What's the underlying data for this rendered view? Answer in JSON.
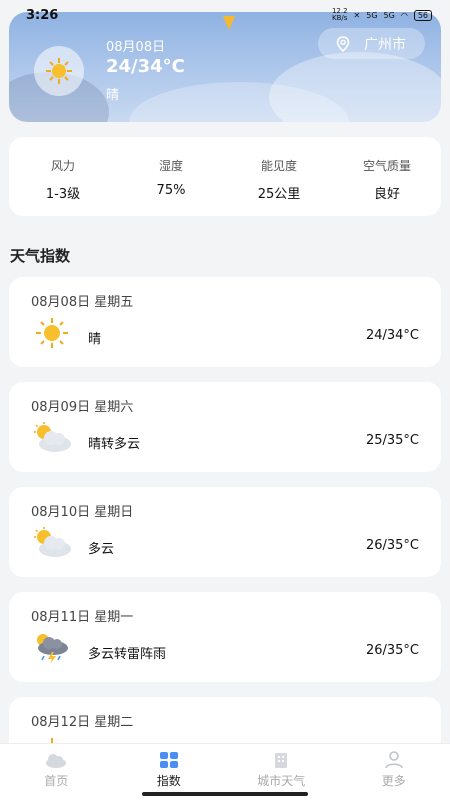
{
  "status": {
    "time": "3:26",
    "speed": "12.2\nKB/s",
    "batt": "56",
    "signal1": "5G",
    "signal2": "5G"
  },
  "hero": {
    "date": "08月08日",
    "temp": "24/34°C",
    "condition": "晴",
    "city": "广州市"
  },
  "stats": [
    {
      "label": "风力",
      "value": "1-3级"
    },
    {
      "label": "湿度",
      "value": "75%"
    },
    {
      "label": "能见度",
      "value": "25公里"
    },
    {
      "label": "空气质量",
      "value": "良好"
    }
  ],
  "section_title": "天气指数",
  "days": [
    {
      "date": "08月08日  星期五",
      "condition": "晴",
      "temp": "24/34°C",
      "icon": "sun-icon"
    },
    {
      "date": "08月09日  星期六",
      "condition": "晴转多云",
      "temp": "25/35°C",
      "icon": "partly-cloudy-icon"
    },
    {
      "date": "08月10日  星期日",
      "condition": "多云",
      "temp": "26/35°C",
      "icon": "partly-cloudy-icon"
    },
    {
      "date": "08月11日  星期一",
      "condition": "多云转雷阵雨",
      "temp": "26/35°C",
      "icon": "thunderstorm-icon"
    },
    {
      "date": "08月12日  星期二",
      "condition": "",
      "temp": "",
      "icon": "sun-icon"
    }
  ],
  "nav": [
    {
      "label": "首页",
      "icon": "cloud-home-icon",
      "active": false
    },
    {
      "label": "指数",
      "icon": "grid-icon",
      "active": true
    },
    {
      "label": "城市天气",
      "icon": "building-icon",
      "active": false
    },
    {
      "label": "更多",
      "icon": "user-icon",
      "active": false
    }
  ],
  "colors": {
    "accent": "#4a8ff0",
    "hero_top": "#8fb2e2",
    "background": "#f3f4f6"
  }
}
